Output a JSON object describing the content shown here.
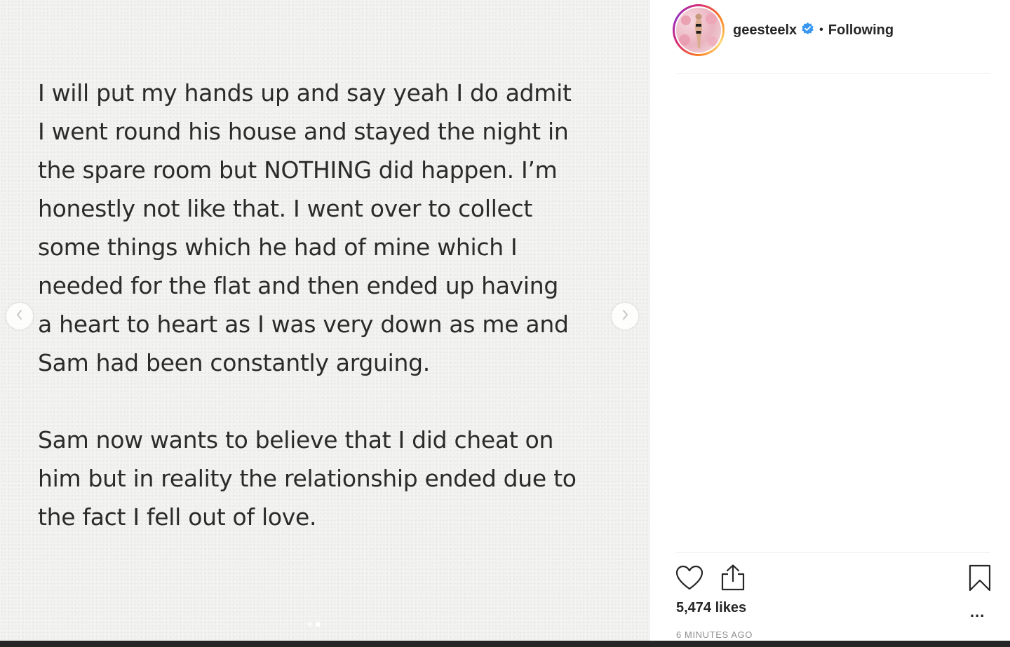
{
  "post": {
    "paragraphs": [
      "I will put my hands up and say yeah I do admit\nI went round his house and stayed the night in\nthe spare room but NOTHING did happen. I’m\nhonestly not like that. I went over to collect\nsome things which he had of mine which I\nneeded for the flat and then ended up having\na heart to heart as I was very down as me and\nSam had been constantly arguing.",
      "Sam now wants to believe that I did cheat on\nhim but in reality the relationship ended due to\nthe fact I fell out of love."
    ],
    "carousel": {
      "slide_count": 2,
      "active_slide": 2
    }
  },
  "header": {
    "username": "geesteelx",
    "verified": true,
    "separator": "•",
    "follow_status": "Following"
  },
  "engagement": {
    "likes": "5,474 likes",
    "timestamp": "6 MINUTES AGO",
    "more_label": "..."
  },
  "icons": {
    "like": "heart-icon",
    "share": "share-icon",
    "save": "bookmark-icon",
    "prev": "chevron-left-icon",
    "next": "chevron-right-icon",
    "verified": "verified-badge-icon"
  },
  "colors": {
    "verified_blue": "#3897f0",
    "text_primary": "#262626",
    "text_secondary": "#8e8e8e",
    "media_bg": "#f3f3f1"
  }
}
